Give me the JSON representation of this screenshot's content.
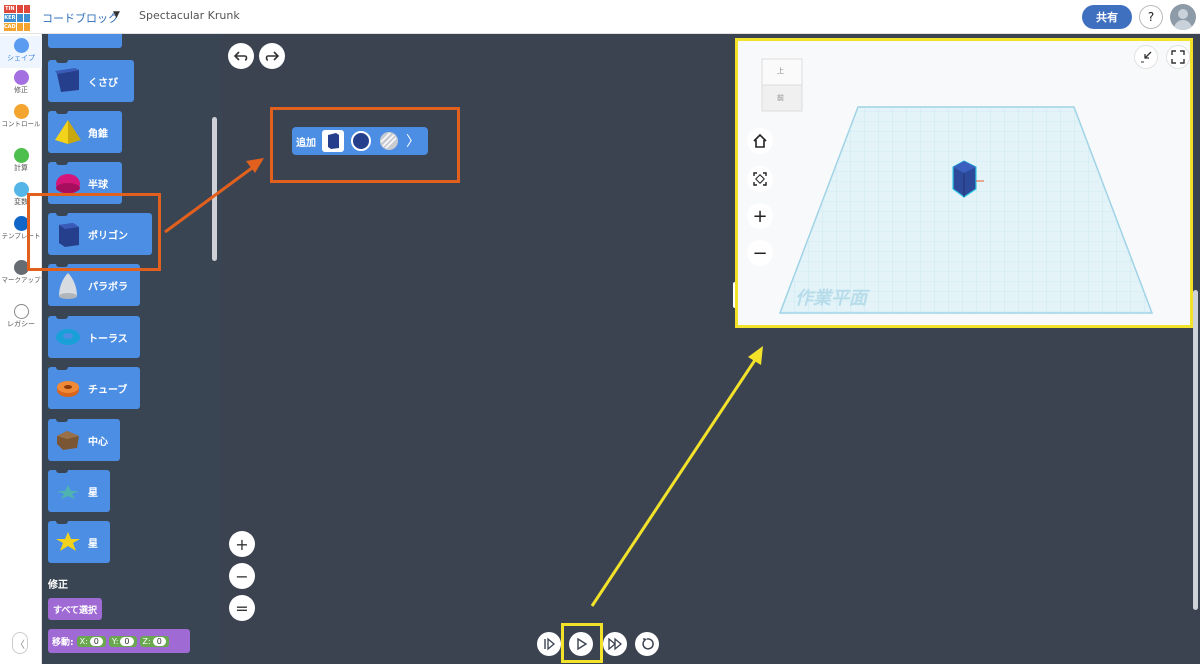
{
  "app": {
    "logo_letters": [
      "TIN",
      "KER",
      "CAD"
    ],
    "mode": "コードブロック",
    "document_name": "Spectacular Krunk",
    "share_label": "共有",
    "help_label": "?"
  },
  "categories": [
    {
      "label": "シェイプ",
      "color": "#5b9cf0",
      "active": true
    },
    {
      "label": "修正",
      "color": "#a46fe0"
    },
    {
      "label": "コントロール",
      "color": "#f3a530"
    },
    {
      "label": "計算",
      "color": "#4cbf4c"
    },
    {
      "label": "変数",
      "color": "#53b6e6"
    },
    {
      "label": "テンプレート",
      "color": "#0f66c8"
    },
    {
      "label": "マークアップ",
      "color": "#666c72"
    },
    {
      "label": "レガシー",
      "color": "#ffffff"
    }
  ],
  "palette": {
    "shapes": [
      {
        "label": "くさび",
        "icon": "wedge-icon"
      },
      {
        "label": "角錐",
        "icon": "pyramid-icon"
      },
      {
        "label": "半球",
        "icon": "half-sphere-icon"
      },
      {
        "label": "ポリゴン",
        "icon": "polygon-icon"
      },
      {
        "label": "パラボラ",
        "icon": "paraboloid-icon"
      },
      {
        "label": "トーラス",
        "icon": "torus-icon"
      },
      {
        "label": "チューブ",
        "icon": "tube-icon"
      },
      {
        "label": "中心",
        "icon": "center-icon"
      },
      {
        "label": "星",
        "icon": "star-icon"
      },
      {
        "label": "星",
        "icon": "star-yellow-icon"
      }
    ],
    "modify_section": "修正",
    "select_all": "すべて選択",
    "move": {
      "label": "移動:",
      "x_label": "X:",
      "x": "0",
      "y_label": "Y:",
      "y": "0",
      "z_label": "Z:",
      "z": "0"
    }
  },
  "workspace": {
    "script_block_label": "追加",
    "undo_icon": "undo-icon",
    "redo_icon": "redo-icon",
    "zoom_in": "+",
    "zoom_out": "−",
    "zoom_reset": "="
  },
  "viewer": {
    "cube_top": "上",
    "cube_front": "前",
    "workplane_label": "作業平面",
    "zoom_in": "+",
    "zoom_out": "−"
  },
  "highlight_colors": {
    "orange": "#e2601d",
    "yellow": "#f2e22a"
  }
}
